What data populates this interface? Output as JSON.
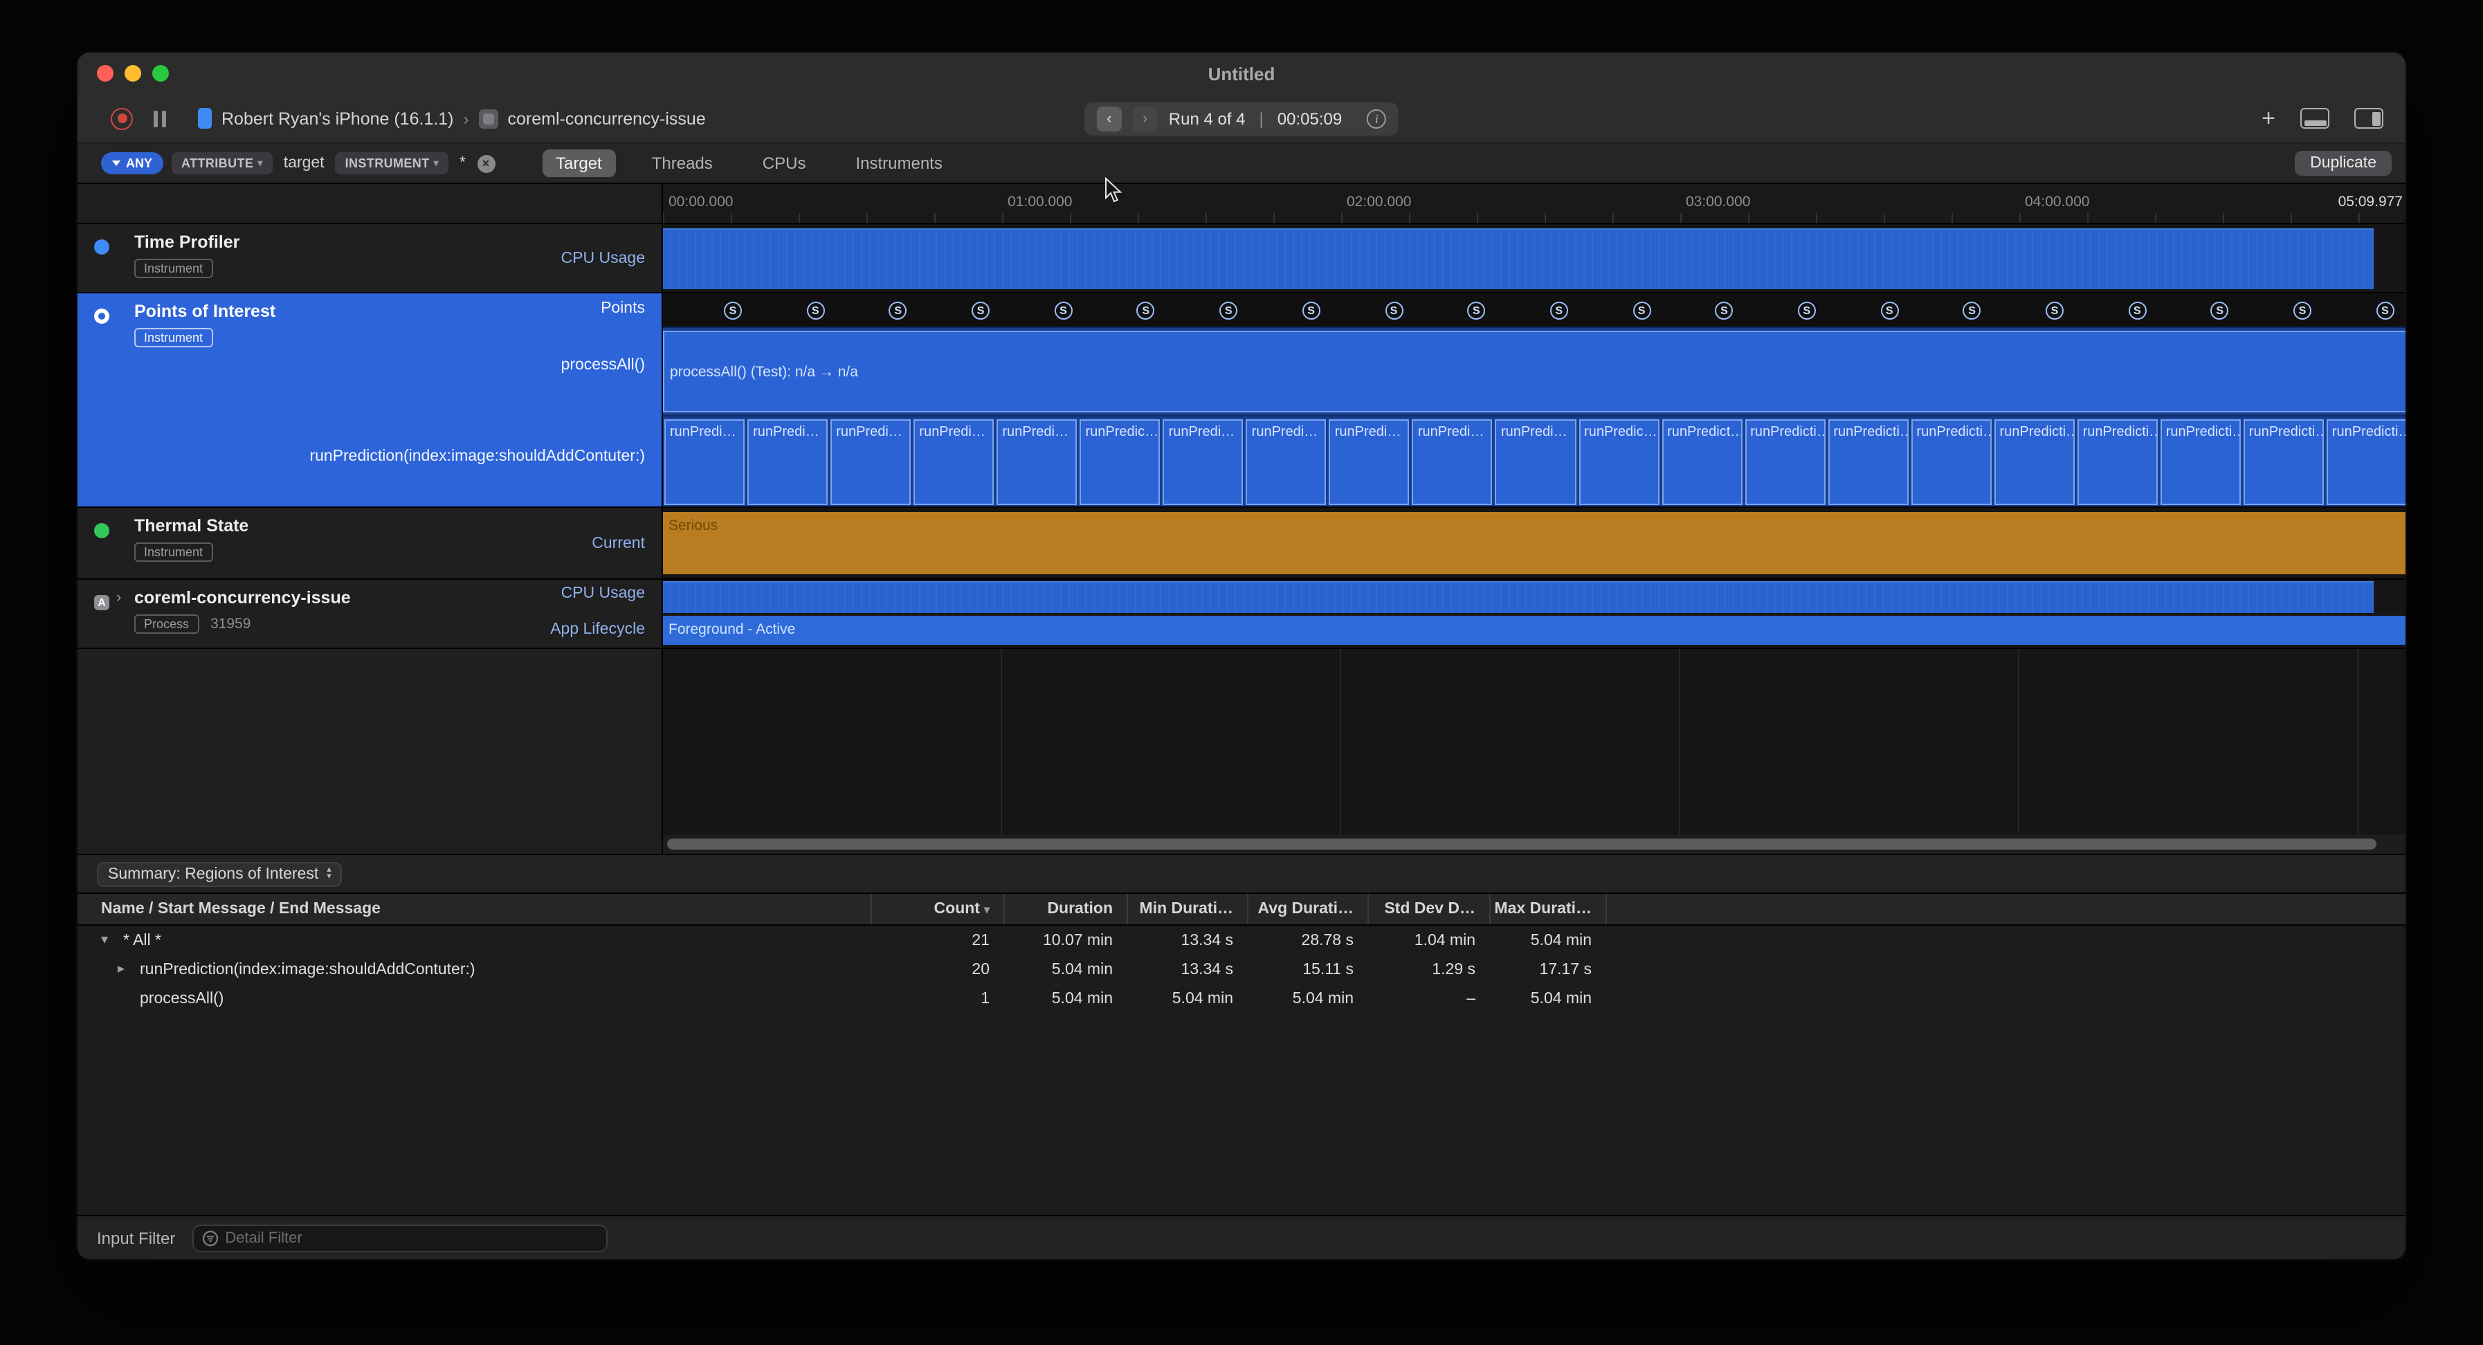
{
  "window": {
    "title": "Untitled"
  },
  "toolbar": {
    "device_name": "Robert Ryan's iPhone (16.1.1)",
    "crumb_separator": "›",
    "target_name": "coreml-concurrency-issue",
    "run_label": "Run 4 of 4",
    "run_divider": "|",
    "run_time": "00:05:09"
  },
  "filterbar": {
    "any_label": "ANY",
    "attribute_label": "ATTRIBUTE",
    "target_text": "target",
    "instrument_label": "INSTRUMENT",
    "wildcard": "*",
    "tabs": [
      {
        "label": "Target",
        "active": true
      },
      {
        "label": "Threads",
        "active": false
      },
      {
        "label": "CPUs",
        "active": false
      },
      {
        "label": "Instruments",
        "active": false
      }
    ],
    "duplicate_label": "Duplicate"
  },
  "ruler": {
    "tick_labels": [
      "00:00.000",
      "01:00.000",
      "02:00.000",
      "03:00.000",
      "04:00.000"
    ],
    "end_label": "05:09.977"
  },
  "tracks": {
    "time_profiler": {
      "title": "Time Profiler",
      "badge": "Instrument",
      "lane_label": "CPU Usage"
    },
    "points_of_interest": {
      "title": "Points of Interest",
      "badge": "Instrument",
      "lane_points_label": "Points",
      "lane_processall_label": "processAll()",
      "lane_runprediction_label": "runPrediction(index:image:shouldAddContuter:)",
      "processall_bar_label": "processAll() (Test): n/a → n/a",
      "sign_glyph": "S",
      "points_count": 21,
      "run_blocks": [
        "runPredi…",
        "runPredi…",
        "runPredi…",
        "runPredi…",
        "runPredi…",
        "runPredic…",
        "runPredi…",
        "runPredi…",
        "runPredi…",
        "runPredi…",
        "runPredi…",
        "runPredic…",
        "runPredict…",
        "runPredicti…",
        "runPredicti…",
        "runPredicti…",
        "runPredicti…",
        "runPredicti…",
        "runPredicti…",
        "runPredicti…",
        "runPredicti…"
      ]
    },
    "thermal_state": {
      "title": "Thermal State",
      "badge": "Instrument",
      "lane_label": "Current",
      "value": "Serious"
    },
    "process": {
      "title": "coreml-concurrency-issue",
      "badge": "Process",
      "pid": "31959",
      "lane_cpu_label": "CPU Usage",
      "lane_lifecycle_label": "App Lifecycle",
      "lifecycle_value": "Foreground - Active"
    }
  },
  "detail": {
    "summary_label": "Summary: Regions of Interest",
    "table": {
      "name_header": "Name / Start Message / End Message",
      "columns": [
        "Count",
        "Duration",
        "Min Durati…",
        "Avg Durati…",
        "Std Dev D…",
        "Max Durati…"
      ],
      "rows": [
        {
          "name": "* All *",
          "disclosure": "open",
          "indent": 0,
          "cells": [
            "21",
            "10.07 min",
            "13.34 s",
            "28.78 s",
            "1.04 min",
            "5.04 min"
          ]
        },
        {
          "name": "runPrediction(index:image:shouldAddContuter:)",
          "disclosure": "closed",
          "indent": 1,
          "cells": [
            "20",
            "5.04 min",
            "13.34 s",
            "15.11 s",
            "1.29 s",
            "17.17 s"
          ]
        },
        {
          "name": "processAll()",
          "disclosure": "none",
          "indent": 1,
          "cells": [
            "1",
            "5.04 min",
            "5.04 min",
            "5.04 min",
            "–",
            "5.04 min"
          ]
        }
      ]
    },
    "input_filter_label": "Input Filter",
    "detail_filter_placeholder": "Detail Filter"
  }
}
